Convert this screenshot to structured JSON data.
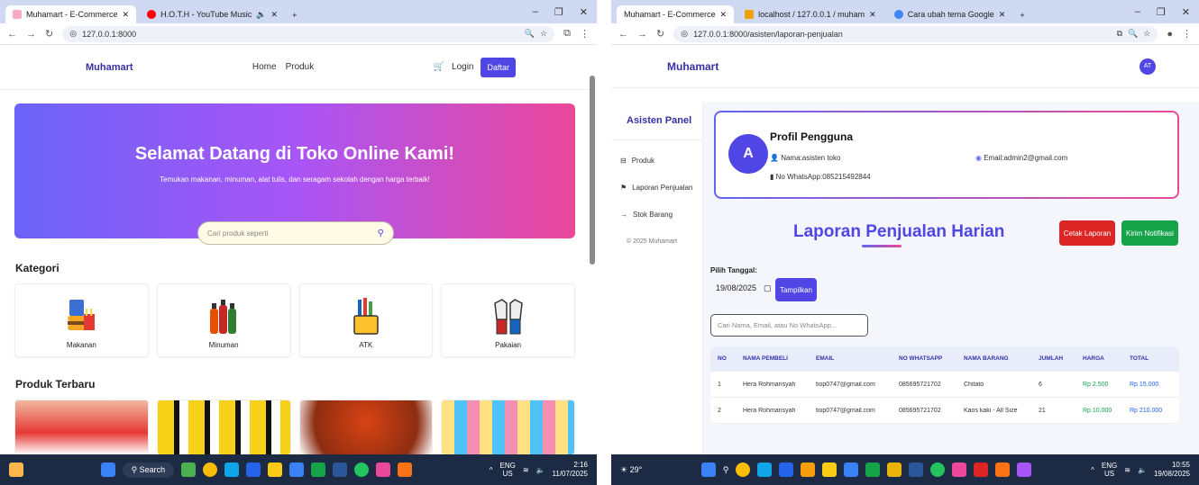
{
  "left": {
    "browser": {
      "tabs": [
        {
          "label": "Muhamart - E-Commerce",
          "active": true
        },
        {
          "label": "H.O.T.H - YouTube Music",
          "active": false
        }
      ],
      "url": "127.0.0.1:8000"
    },
    "site": {
      "brand": "Muhamart",
      "nav": {
        "home": "Home",
        "produk": "Produk",
        "login": "Login",
        "daftar": "Daftar"
      },
      "hero": {
        "title": "Selamat Datang di Toko Online Kami!",
        "subtitle": "Temukan makanan, minuman, alat tulis, dan seragam sekolah dengan harga terbaik!",
        "search_placeholder": "Cari produk seperti"
      },
      "kategori_title": "Kategori",
      "kategori": [
        "Makanan",
        "Minuman",
        "ATK",
        "Pakaian"
      ],
      "produk_title": "Produk Terbaru"
    },
    "taskbar": {
      "search": "Search",
      "lang1": "ENG",
      "lang2": "US",
      "time": "2:16",
      "date": "11/07/2025"
    }
  },
  "right": {
    "browser": {
      "tabs": [
        {
          "label": "Muhamart - E-Commerce",
          "active": true
        },
        {
          "label": "localhost / 127.0.0.1 / muham",
          "active": false
        },
        {
          "label": "Cara ubah tema Google",
          "active": false
        }
      ],
      "url": "127.0.0.1:8000/asisten/laporan-penjualan"
    },
    "site": {
      "brand": "Muhamart",
      "avatar": "AT",
      "sidebar": {
        "title": "Asisten Panel",
        "items": [
          "Produk",
          "Laporan Penjualan",
          "Stok Barang"
        ],
        "footer": "© 2025 Muhamart"
      },
      "profile": {
        "initial": "A",
        "title": "Profil Pengguna",
        "nama": "Nama:asisten toko",
        "email": "Email:admin2@gmail.com",
        "whatsapp": "No WhatsApp:085215492844"
      },
      "report_title": "Laporan Penjualan Harian",
      "buttons": {
        "cetak": "Cetak Laporan",
        "kirim": "Kirim Notifikasi",
        "tampilkan": "Tampilkan"
      },
      "date_label": "Pilih Tanggal:",
      "date_value": "19/08/2025",
      "search_placeholder": "Cari Nama, Email, atau No WhatsApp...",
      "table": {
        "headers": [
          "NO",
          "NAMA PEMBELI",
          "EMAIL",
          "NO WHATSAPP",
          "NAMA BARANG",
          "JUMLAH",
          "HARGA",
          "TOTAL"
        ],
        "rows": [
          [
            "1",
            "Hera Rohmansyah",
            "tiop0747@gmail.com",
            "085695721702",
            "Chitato",
            "6",
            "Rp 2.500",
            "Rp 15.000"
          ],
          [
            "2",
            "Hera Rohmansyah",
            "tiop0747@gmail.com",
            "085695721702",
            "Kaos kaki - All Size",
            "21",
            "Rp 10.000",
            "Rp 210.000"
          ]
        ]
      }
    },
    "taskbar": {
      "temp": "29°",
      "lang1": "ENG",
      "lang2": "US",
      "time": "10:55",
      "date": "19/08/2025"
    }
  }
}
